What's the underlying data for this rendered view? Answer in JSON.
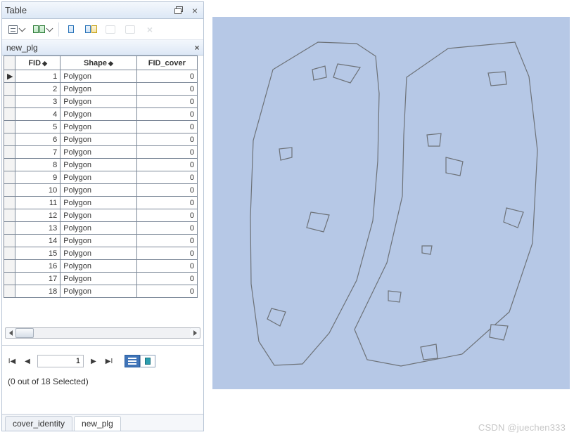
{
  "panel": {
    "title": "Table",
    "restore_icon_label": "restore",
    "close_icon_label": "×"
  },
  "toolbar": {
    "options_menu": "Table Options",
    "related": "Related Tables",
    "select_by_attr": "Select By Attributes",
    "switch_selection": "Switch Selection",
    "copy": "Copy",
    "export": "Export",
    "remove": "Remove"
  },
  "subheader": {
    "layer_name": "new_plg",
    "close": "×"
  },
  "table": {
    "columns": [
      {
        "label": "FID",
        "sortable": true
      },
      {
        "label": "Shape",
        "sortable": true
      },
      {
        "label": "FID_cover",
        "sortable": false
      }
    ],
    "rows": [
      {
        "FID": 1,
        "Shape": "Polygon",
        "FID_cover": 0,
        "current": true
      },
      {
        "FID": 2,
        "Shape": "Polygon",
        "FID_cover": 0
      },
      {
        "FID": 3,
        "Shape": "Polygon",
        "FID_cover": 0
      },
      {
        "FID": 4,
        "Shape": "Polygon",
        "FID_cover": 0
      },
      {
        "FID": 5,
        "Shape": "Polygon",
        "FID_cover": 0
      },
      {
        "FID": 6,
        "Shape": "Polygon",
        "FID_cover": 0
      },
      {
        "FID": 7,
        "Shape": "Polygon",
        "FID_cover": 0
      },
      {
        "FID": 8,
        "Shape": "Polygon",
        "FID_cover": 0
      },
      {
        "FID": 9,
        "Shape": "Polygon",
        "FID_cover": 0
      },
      {
        "FID": 10,
        "Shape": "Polygon",
        "FID_cover": 0
      },
      {
        "FID": 11,
        "Shape": "Polygon",
        "FID_cover": 0
      },
      {
        "FID": 12,
        "Shape": "Polygon",
        "FID_cover": 0
      },
      {
        "FID": 13,
        "Shape": "Polygon",
        "FID_cover": 0
      },
      {
        "FID": 14,
        "Shape": "Polygon",
        "FID_cover": 0
      },
      {
        "FID": 15,
        "Shape": "Polygon",
        "FID_cover": 0
      },
      {
        "FID": 16,
        "Shape": "Polygon",
        "FID_cover": 0
      },
      {
        "FID": 17,
        "Shape": "Polygon",
        "FID_cover": 0
      },
      {
        "FID": 18,
        "Shape": "Polygon",
        "FID_cover": 0
      }
    ]
  },
  "nav": {
    "first": "I◀",
    "prev": "◀",
    "page_value": "1",
    "next": "▶",
    "last": "▶I",
    "show_all": "Show all",
    "show_selected": "Show selected"
  },
  "status": {
    "text": "(0 out of 18 Selected)"
  },
  "tabs": [
    {
      "label": "cover_identity",
      "active": false
    },
    {
      "label": "new_plg",
      "active": true
    }
  ],
  "colors": {
    "map_bg": "#b6c8e6",
    "stroke": "#6d7278",
    "panel_border": "#b8c5d6"
  },
  "watermark": "CSDN @juechen333"
}
